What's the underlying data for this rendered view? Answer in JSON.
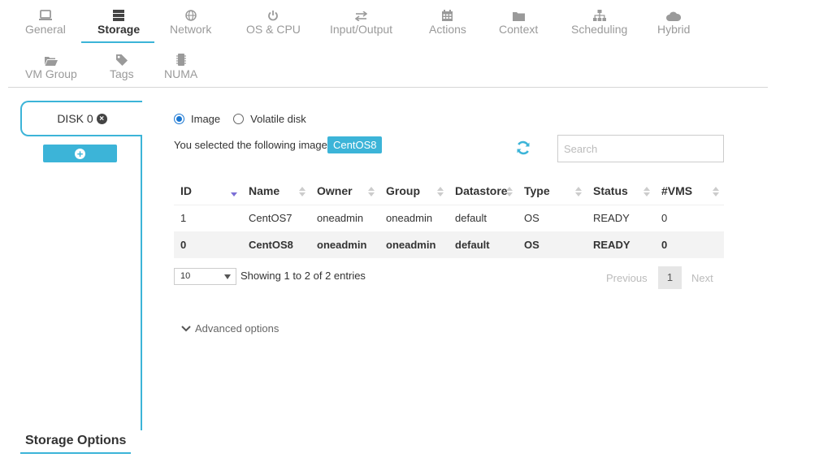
{
  "tabs": {
    "row1": [
      {
        "label": "General",
        "icon": "laptop-icon"
      },
      {
        "label": "Storage",
        "icon": "database-icon",
        "active": true
      },
      {
        "label": "Network",
        "icon": "globe-icon"
      },
      {
        "label": "OS & CPU",
        "icon": "power-icon"
      },
      {
        "label": "Input/Output",
        "icon": "exchange-icon"
      },
      {
        "label": "Actions",
        "icon": "calendar-icon"
      },
      {
        "label": "Context",
        "icon": "folder-icon"
      },
      {
        "label": "Scheduling",
        "icon": "sitemap-icon"
      },
      {
        "label": "Hybrid",
        "icon": "cloud-icon"
      }
    ],
    "row2": [
      {
        "label": "VM Group",
        "icon": "folder-open-icon"
      },
      {
        "label": "Tags",
        "icon": "tag-icon"
      },
      {
        "label": "NUMA",
        "icon": "microchip-icon"
      }
    ]
  },
  "disks": {
    "tab_label": "DISK 0",
    "remove_icon": "close-icon",
    "add_icon": "plus-icon"
  },
  "sidebar": {
    "storage_options": "Storage Options"
  },
  "source": {
    "radio_image": "Image",
    "radio_volatile": "Volatile disk",
    "selected": "image"
  },
  "selection": {
    "text": "You selected the following image:",
    "badge": "CentOS8"
  },
  "search": {
    "placeholder": "Search",
    "value": ""
  },
  "table": {
    "columns": [
      "ID",
      "Name",
      "Owner",
      "Group",
      "Datastore",
      "Type",
      "Status",
      "#VMS"
    ],
    "rows": [
      [
        "1",
        "CentOS7",
        "oneadmin",
        "oneadmin",
        "default",
        "OS",
        "READY",
        "0"
      ],
      [
        "0",
        "CentOS8",
        "oneadmin",
        "oneadmin",
        "default",
        "OS",
        "READY",
        "0"
      ]
    ],
    "selected_row": 1,
    "sort_column": "ID",
    "sort_direction": "descending"
  },
  "pagination": {
    "length": "10",
    "showing": "Showing 1 to 2 of 2 entries",
    "previous": "Previous",
    "page": "1",
    "next": "Next"
  },
  "advanced": {
    "label": "Advanced options"
  },
  "colors": {
    "accent": "#3cb4d8",
    "radio": "#1976d2",
    "sort_active": "#7b6fd6"
  }
}
